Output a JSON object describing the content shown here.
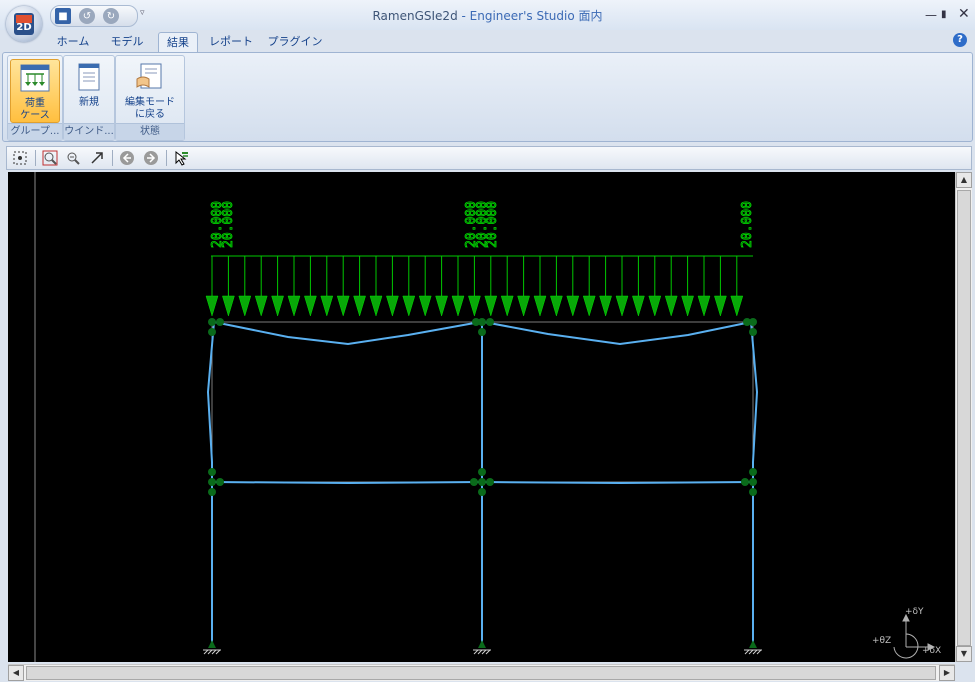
{
  "window": {
    "title_app": "RamenGSIe2d",
    "title_rest": " - Engineer's Studio 面内",
    "app_logo": "2D",
    "minimize_icon": "minimize-icon",
    "maximize_icon": "maximize-icon",
    "close_icon": "close-icon"
  },
  "tabs": [
    "ホーム",
    "モデル",
    "結果",
    "レポート",
    "プラグイン"
  ],
  "active_tab": "結果",
  "ribbon": {
    "groups": [
      {
        "label": "グループ...",
        "button_line1": "荷重",
        "button_line2": "ケース"
      },
      {
        "label": "ウインド...",
        "button_line1": "新規",
        "button_line2": ""
      },
      {
        "label": "状態",
        "button_line1": "編集モード",
        "button_line2": "に戻る"
      }
    ]
  },
  "toolbar_icons": [
    "select-icon",
    "zoom-window-icon",
    "zoom-out-icon",
    "arrow-icon",
    "back-icon",
    "forward-icon",
    "pointer-icon"
  ],
  "view": {
    "load_labels": [
      "20.000",
      "20.000",
      "20.000",
      "20.000",
      "20.000",
      "20.000"
    ],
    "axis_labels": {
      "y": "+δY",
      "x": "+δX",
      "z": "+θZ"
    },
    "colors": {
      "background": "#000000",
      "load": "#00d000",
      "member": "#5ab0f0",
      "node": "#0a6a1a",
      "frame_outline": "#7a7a7a"
    }
  }
}
